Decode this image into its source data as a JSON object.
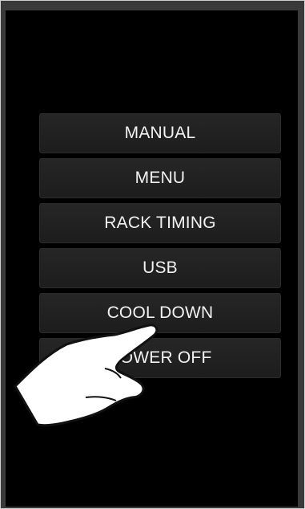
{
  "menu": {
    "items": [
      {
        "label": "MANUAL",
        "name": "manual-button"
      },
      {
        "label": "MENU",
        "name": "menu-button"
      },
      {
        "label": "RACK TIMING",
        "name": "rack-timing-button"
      },
      {
        "label": "USB",
        "name": "usb-button"
      },
      {
        "label": "COOL DOWN",
        "name": "cool-down-button"
      },
      {
        "label": "POWER OFF",
        "name": "power-off-button"
      }
    ]
  },
  "overlay": {
    "icon": "pointing-hand-icon"
  },
  "colors": {
    "screen_background": "#000000",
    "button_background": "#1f1f1f",
    "button_text": "#f2f2f2"
  }
}
